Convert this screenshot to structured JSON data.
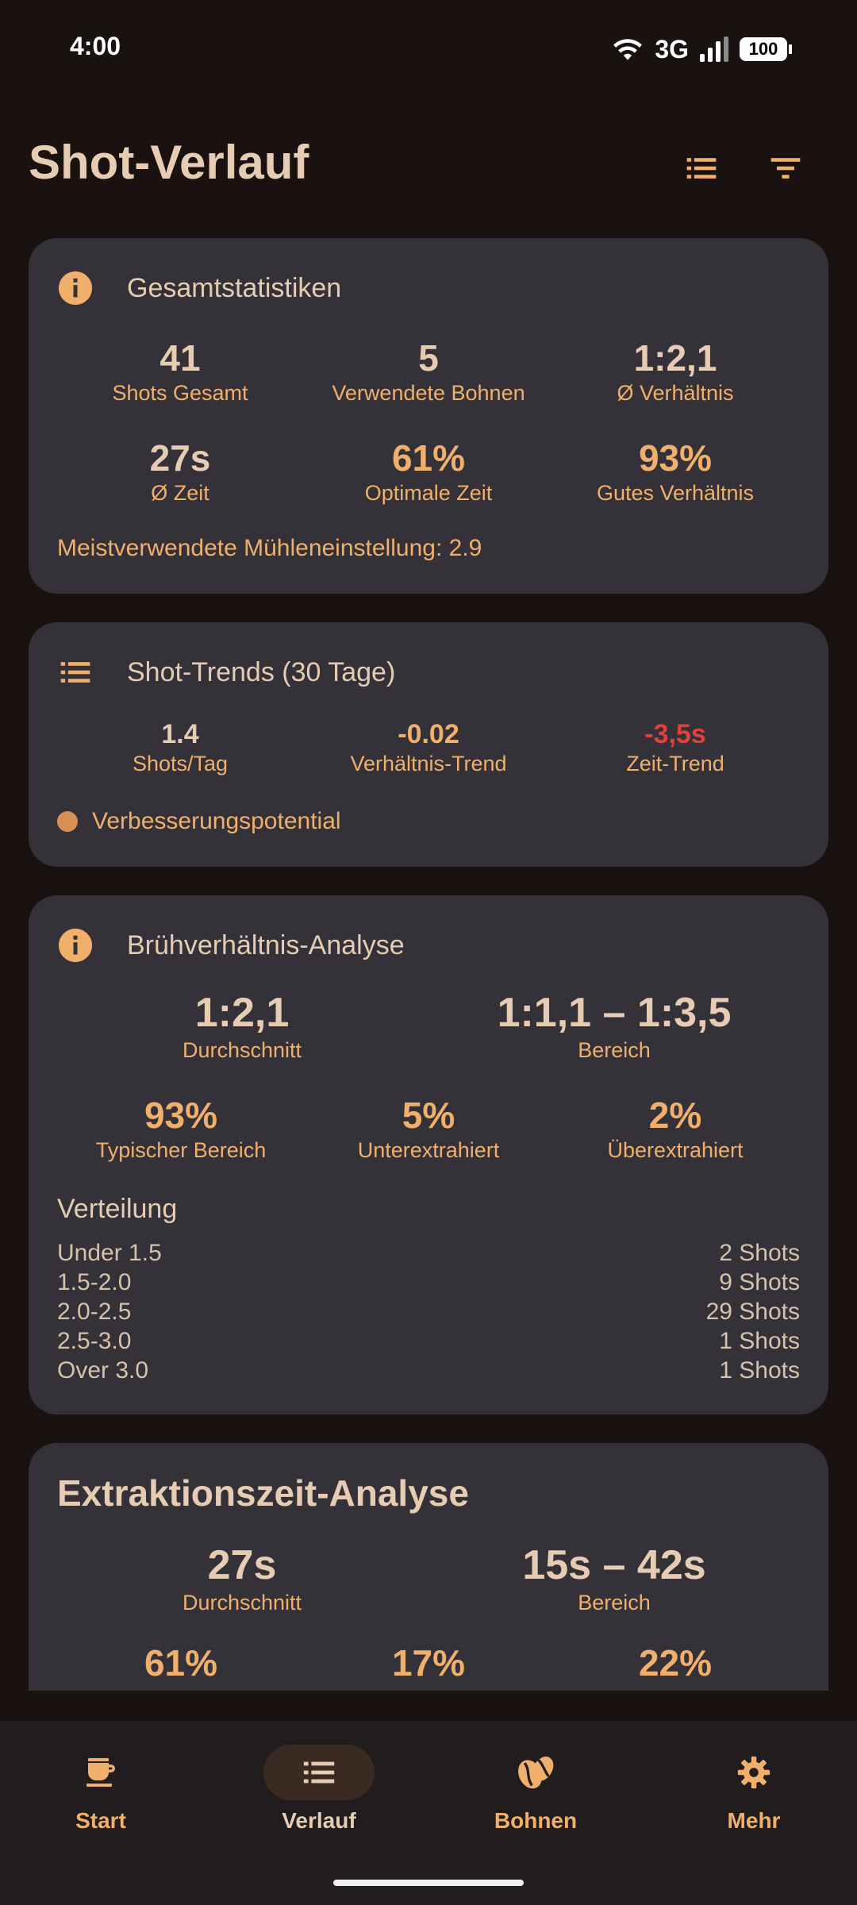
{
  "status": {
    "time": "4:00",
    "network": "3G",
    "battery": "100"
  },
  "header": {
    "title": "Shot-Verlauf"
  },
  "overall": {
    "title": "Gesamtstatistiken",
    "stats": [
      {
        "value": "41",
        "label": "Shots Gesamt"
      },
      {
        "value": "5",
        "label": "Verwendete Bohnen"
      },
      {
        "value": "1:2,1",
        "label": "Ø Verhältnis"
      },
      {
        "value": "27s",
        "label": "Ø Zeit"
      },
      {
        "value": "61%",
        "label": "Optimale Zeit"
      },
      {
        "value": "93%",
        "label": "Gutes Verhältnis"
      }
    ],
    "grinder_note": "Meistverwendete Mühleneinstellung: 2.9"
  },
  "trends": {
    "title": "Shot-Trends (30 Tage)",
    "stats": [
      {
        "value": "1.4",
        "label": "Shots/Tag"
      },
      {
        "value": "-0.02",
        "label": "Verhältnis-Trend"
      },
      {
        "value": "-3,5s",
        "label": "Zeit-Trend"
      }
    ],
    "status_label": "Verbesserungspotential"
  },
  "ratio": {
    "title": "Brühverhältnis-Analyse",
    "average": {
      "value": "1:2,1",
      "label": "Durchschnitt"
    },
    "range": {
      "value": "1:1,1 – 1:3,5",
      "label": "Bereich"
    },
    "stats": [
      {
        "value": "93%",
        "label": "Typischer Bereich"
      },
      {
        "value": "5%",
        "label": "Unterextrahiert"
      },
      {
        "value": "2%",
        "label": "Überextrahiert"
      }
    ],
    "distribution_title": "Verteilung",
    "distribution": [
      {
        "range": "Under 1.5",
        "count": "2 Shots"
      },
      {
        "range": "1.5-2.0",
        "count": "9 Shots"
      },
      {
        "range": "2.0-2.5",
        "count": "29 Shots"
      },
      {
        "range": "2.5-3.0",
        "count": "1 Shots"
      },
      {
        "range": "Over 3.0",
        "count": "1 Shots"
      }
    ]
  },
  "extraction": {
    "title": "Extraktionszeit-Analyse",
    "average": {
      "value": "27s",
      "label": "Durchschnitt"
    },
    "range": {
      "value": "15s – 42s",
      "label": "Bereich"
    },
    "stats": [
      {
        "value": "61%"
      },
      {
        "value": "17%"
      },
      {
        "value": "22%"
      }
    ]
  },
  "nav": {
    "items": [
      {
        "label": "Start",
        "icon": "coffee-cup-icon"
      },
      {
        "label": "Verlauf",
        "icon": "list-icon",
        "active": true
      },
      {
        "label": "Bohnen",
        "icon": "coffee-bean-icon"
      },
      {
        "label": "Mehr",
        "icon": "gear-icon"
      }
    ]
  },
  "colors": {
    "accent": "#f0b06c",
    "text": "#e6ccb2",
    "card": "#343238",
    "background": "#1a1210",
    "negative": "#e0413b"
  }
}
